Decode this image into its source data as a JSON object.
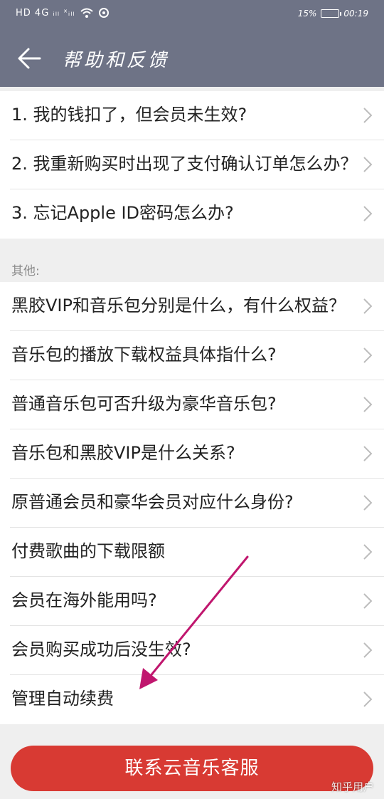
{
  "status_bar": {
    "left_text": "HD 4G ᵢₗₗ ˣᵢₗₗ",
    "battery": "15%",
    "time": "00:19"
  },
  "nav": {
    "title": "帮助和反馈"
  },
  "group1": {
    "items": [
      {
        "label": "1. 我的钱扣了，但会员未生效?"
      },
      {
        "label": "2. 我重新购买时出现了支付确认订单怎么办？"
      },
      {
        "label": "3. 忘记Apple ID密码怎么办?"
      }
    ]
  },
  "section_other": "其他:",
  "group2": {
    "items": [
      {
        "label": "黑胶VIP和音乐包分别是什么，有什么权益？"
      },
      {
        "label": "音乐包的播放下载权益具体指什么?"
      },
      {
        "label": "普通音乐包可否升级为豪华音乐包?"
      },
      {
        "label": "音乐包和黑胶VIP是什么关系?"
      },
      {
        "label": "原普通会员和豪华会员对应什么身份?"
      },
      {
        "label": "付费歌曲的下载限额"
      },
      {
        "label": "会员在海外能用吗?"
      },
      {
        "label": "会员购买成功后没生效?"
      },
      {
        "label": "管理自动续费"
      }
    ]
  },
  "contact_button": "联系云音乐客服",
  "watermark": "知乎用户",
  "colors": {
    "header": "#6e7386",
    "button": "#d83a33",
    "annotation_arrow": "#c0166e"
  }
}
